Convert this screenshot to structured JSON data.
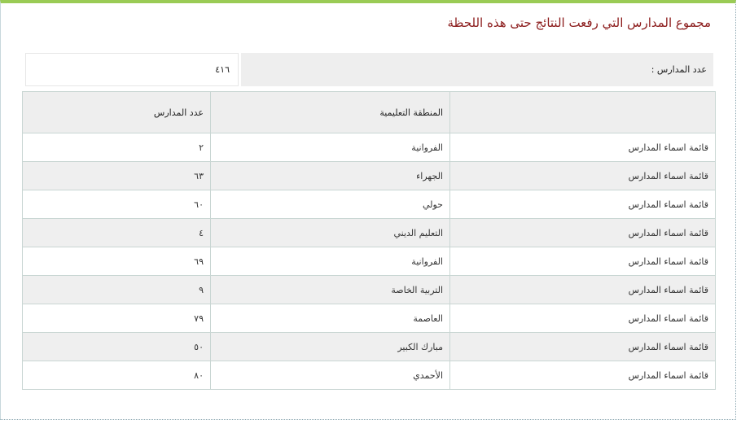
{
  "page": {
    "title": "مجموع المدارس التي رفعت النتائج حتى هذه اللحظة",
    "count_label": "عدد المدارس :",
    "count_value": "٤١٦"
  },
  "table": {
    "headers": [
      "",
      "المنطقة التعليمية",
      "عدد المدارس"
    ],
    "rows": [
      {
        "link": "قائمة اسماء المدارس",
        "region": "الفروانية",
        "count": "٢"
      },
      {
        "link": "قائمة اسماء المدارس",
        "region": "الجهراء",
        "count": "٦٣"
      },
      {
        "link": "قائمة اسماء المدارس",
        "region": "حولي",
        "count": "٦٠"
      },
      {
        "link": "قائمة اسماء المدارس",
        "region": "التعليم الديني",
        "count": "٤"
      },
      {
        "link": "قائمة اسماء المدارس",
        "region": "الفروانية",
        "count": "٦٩"
      },
      {
        "link": "قائمة اسماء المدارس",
        "region": "التربية الخاصة",
        "count": "٩"
      },
      {
        "link": "قائمة اسماء المدارس",
        "region": "العاصمة",
        "count": "٧٩"
      },
      {
        "link": "قائمة اسماء المدارس",
        "region": "مبارك الكبير",
        "count": "٥٠"
      },
      {
        "link": "قائمة اسماء المدارس",
        "region": "الأحمدي",
        "count": "٨٠"
      }
    ]
  },
  "colors": {
    "top_border": "#9acb55",
    "title": "#8b1a1a",
    "header_bg": "#eeeeee",
    "row_alt_bg": "#efefef"
  }
}
